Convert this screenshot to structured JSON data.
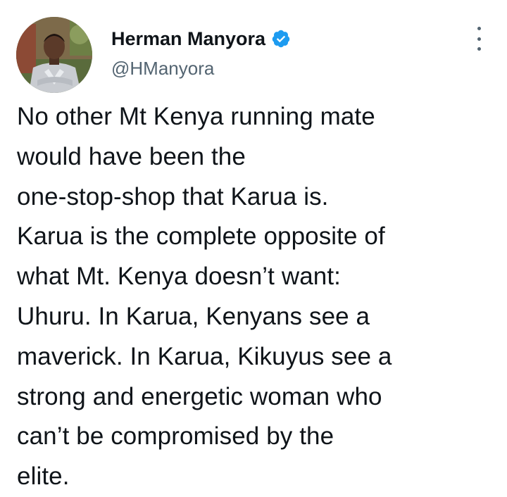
{
  "author": {
    "display_name": "Herman Manyora",
    "handle": "@HManyora",
    "verified": true,
    "avatar_icon": "profile-photo"
  },
  "tweet": {
    "text": "No other Mt Kenya running mate\nwould have been the\none-stop-shop that Karua is.\nKarua is the complete opposite of\nwhat Mt. Kenya doesn’t want:\nUhuru. In Karua, Kenyans see a\nmaverick. In Karua, Kikuyus see a\nstrong and energetic woman who\ncan’t be compromised by the\nelite."
  },
  "icons": {
    "verified": "verified-badge-icon",
    "more": "more-options-icon"
  },
  "colors": {
    "verified_blue": "#1d9bf0",
    "text_primary": "#0f1419",
    "text_secondary": "#536471"
  }
}
